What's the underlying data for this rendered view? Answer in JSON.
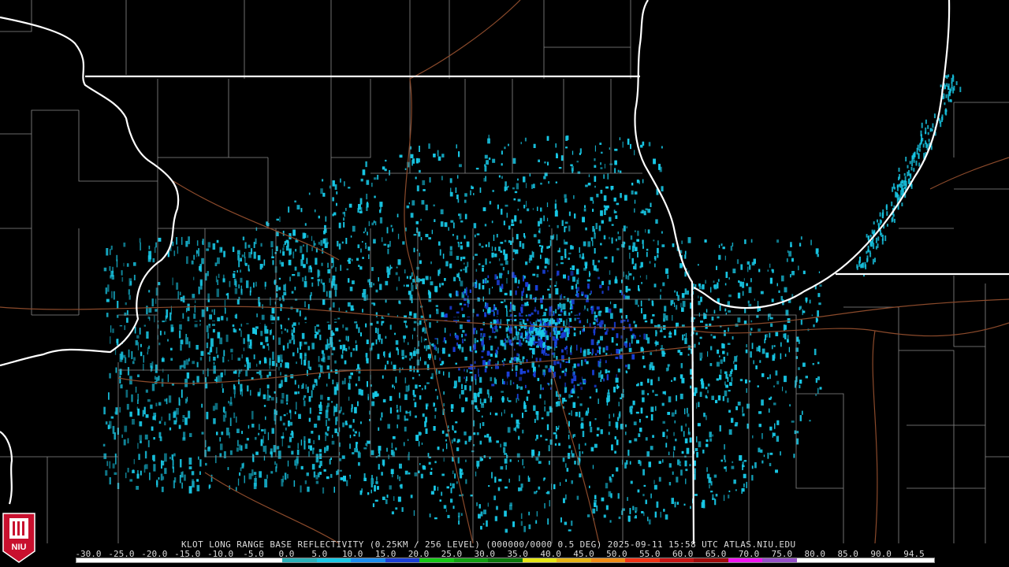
{
  "caption": "KLOT LONG RANGE BASE REFLECTIVITY (0.25KM / 256 LEVEL) (000000/0000 0.5 DEG) 2025-09-11 15:58 UTC  ATLAS.NIU.EDU",
  "logo_text": "NIU",
  "colors": {
    "background": "#000000",
    "state_border": "#ffffff",
    "county_border": "#8a8a8a",
    "highway": "#8b4a2b",
    "echo_light": "#18c8e6",
    "echo_dark": "#1a3fd8"
  },
  "scale": {
    "values": [
      "-30.0",
      "-25.0",
      "-20.0",
      "-15.0",
      "-10.0",
      "-5.0",
      "0.0",
      "5.0",
      "10.0",
      "15.0",
      "20.0",
      "25.0",
      "30.0",
      "35.0",
      "40.0",
      "45.0",
      "50.0",
      "55.0",
      "60.0",
      "65.0",
      "70.0",
      "75.0",
      "80.0",
      "85.0",
      "90.0",
      "94.5"
    ],
    "colors": [
      "#ffffff",
      "#ffffff",
      "#ffffff",
      "#ffffff",
      "#ffffff",
      "#ffffff",
      "#2ab0b8",
      "#18c8e6",
      "#1a8ef0",
      "#1a3fd8",
      "#14c814",
      "#10a010",
      "#0a780a",
      "#e6e614",
      "#e6b414",
      "#f08c14",
      "#f03214",
      "#c81414",
      "#a00a0a",
      "#f014f0",
      "#9650c8",
      "#ffffff",
      "#ffffff",
      "#ffffff",
      "#ffffff"
    ]
  }
}
